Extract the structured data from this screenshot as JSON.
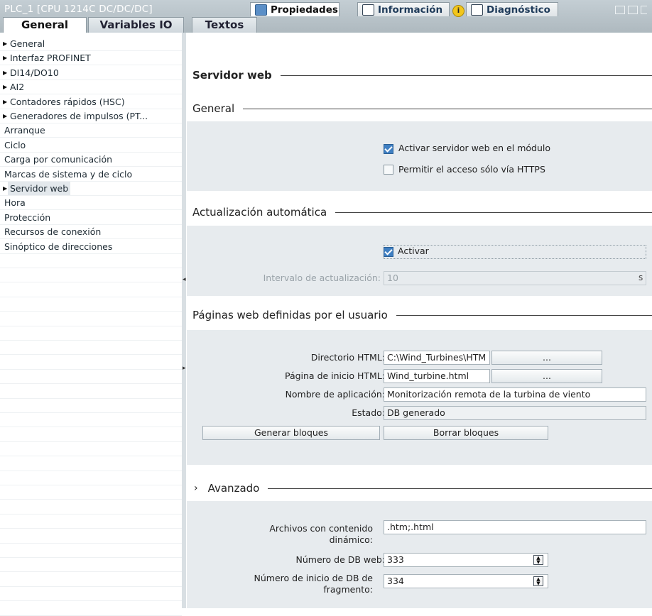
{
  "window": {
    "device_title": "PLC_1 [CPU 1214C DC/DC/DC]",
    "tabs": [
      {
        "label": "Propiedades",
        "icon": "properties-icon"
      },
      {
        "label": "Información",
        "icon": "info-icon"
      },
      {
        "label": "Diagnóstico",
        "icon": "diagnostics-icon"
      }
    ],
    "info_badge": "i"
  },
  "subtabs": [
    "General",
    "Variables IO",
    "Textos"
  ],
  "tree": [
    {
      "label": "General",
      "expandable": true
    },
    {
      "label": "Interfaz PROFINET",
      "expandable": true
    },
    {
      "label": "DI14/DO10",
      "expandable": true
    },
    {
      "label": "AI2",
      "expandable": true
    },
    {
      "label": "Contadores rápidos (HSC)",
      "expandable": true
    },
    {
      "label": "Generadores de impulsos (PT...",
      "expandable": true
    },
    {
      "label": "Arranque",
      "expandable": false
    },
    {
      "label": "Ciclo",
      "expandable": false
    },
    {
      "label": "Carga por comunicación",
      "expandable": false
    },
    {
      "label": "Marcas de sistema y de ciclo",
      "expandable": false
    },
    {
      "label": "Servidor web",
      "expandable": true,
      "selected": true
    },
    {
      "label": "Hora",
      "expandable": false
    },
    {
      "label": "Protección",
      "expandable": false
    },
    {
      "label": "Recursos de conexión",
      "expandable": false
    },
    {
      "label": "Sinóptico de direcciones",
      "expandable": false
    }
  ],
  "content": {
    "title": "Servidor web",
    "general": {
      "heading": "General",
      "enable_label": "Activar servidor web en el módulo",
      "enable_checked": true,
      "https_label": "Permitir el acceso sólo vía HTTPS",
      "https_checked": false
    },
    "auto_update": {
      "heading": "Actualización automática",
      "activate_label": "Activar",
      "activate_checked": true,
      "interval_label": "Intervalo de actualización:",
      "interval_value": "10",
      "interval_unit": "s"
    },
    "user_pages": {
      "heading": "Páginas web definidas por el usuario",
      "html_dir_label": "Directorio HTML:",
      "html_dir_value": "C:\\Wind_Turbines\\HTM",
      "browse_label": "...",
      "start_page_label": "Página de inicio HTML:",
      "start_page_value": "Wind_turbine.html",
      "app_name_label": "Nombre de aplicación:",
      "app_name_value": "Monitorización remota de la turbina de viento",
      "status_label": "Estado:",
      "status_value": "DB generado",
      "generate_button": "Generar bloques",
      "delete_button": "Borrar bloques"
    },
    "advanced": {
      "heading": "Avanzado",
      "expander": "›",
      "dynamic_files_label": "Archivos con contenido dinámico:",
      "dynamic_files_value": ".htm;.html",
      "web_db_label": "Número de DB web:",
      "web_db_value": "333",
      "fragment_db_label": "Número de inicio de DB de fragmento:",
      "fragment_db_value": "334"
    }
  }
}
